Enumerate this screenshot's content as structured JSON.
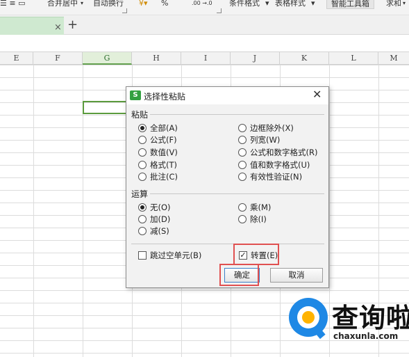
{
  "ribbon": {
    "merge_center": "合并居中",
    "auto_wrap": "自动换行",
    "percent": "%",
    "cond_format": "条件格式",
    "table_style": "表格样式",
    "smart_toolbox": "智能工具箱",
    "sum": "求和"
  },
  "tabs": {
    "close_glyph": "×",
    "add_glyph": "+"
  },
  "columns": [
    "E",
    "F",
    "G",
    "H",
    "I",
    "J",
    "K",
    "L",
    "M"
  ],
  "selected_column": "G",
  "dialog": {
    "title": "选择性粘贴",
    "close_glyph": "✕",
    "paste_section": "粘贴",
    "paste_options_left": [
      {
        "label": "全部(A)",
        "selected": true
      },
      {
        "label": "公式(F)",
        "selected": false
      },
      {
        "label": "数值(V)",
        "selected": false
      },
      {
        "label": "格式(T)",
        "selected": false
      },
      {
        "label": "批注(C)",
        "selected": false
      }
    ],
    "paste_options_right": [
      {
        "label": "边框除外(X)",
        "selected": false
      },
      {
        "label": "列宽(W)",
        "selected": false
      },
      {
        "label": "公式和数字格式(R)",
        "selected": false
      },
      {
        "label": "值和数字格式(U)",
        "selected": false
      },
      {
        "label": "有效性验证(N)",
        "selected": false
      }
    ],
    "operation_section": "运算",
    "operation_options_left": [
      {
        "label": "无(O)",
        "selected": true
      },
      {
        "label": "加(D)",
        "selected": false
      },
      {
        "label": "减(S)",
        "selected": false
      }
    ],
    "operation_options_right": [
      {
        "label": "乘(M)",
        "selected": false
      },
      {
        "label": "除(I)",
        "selected": false
      }
    ],
    "skip_blanks": {
      "label": "跳过空单元(B)",
      "checked": false
    },
    "transpose": {
      "label": "转置(E)",
      "checked": true,
      "check_glyph": "✓"
    },
    "ok_label": "确定",
    "cancel_label": "取消"
  },
  "watermark": {
    "cn": "查询啦",
    "en": "chaxunla.com"
  },
  "colors": {
    "accent_green": "#5b9b3d",
    "highlight_red": "#e05050",
    "brand_blue": "#1e88e5"
  }
}
